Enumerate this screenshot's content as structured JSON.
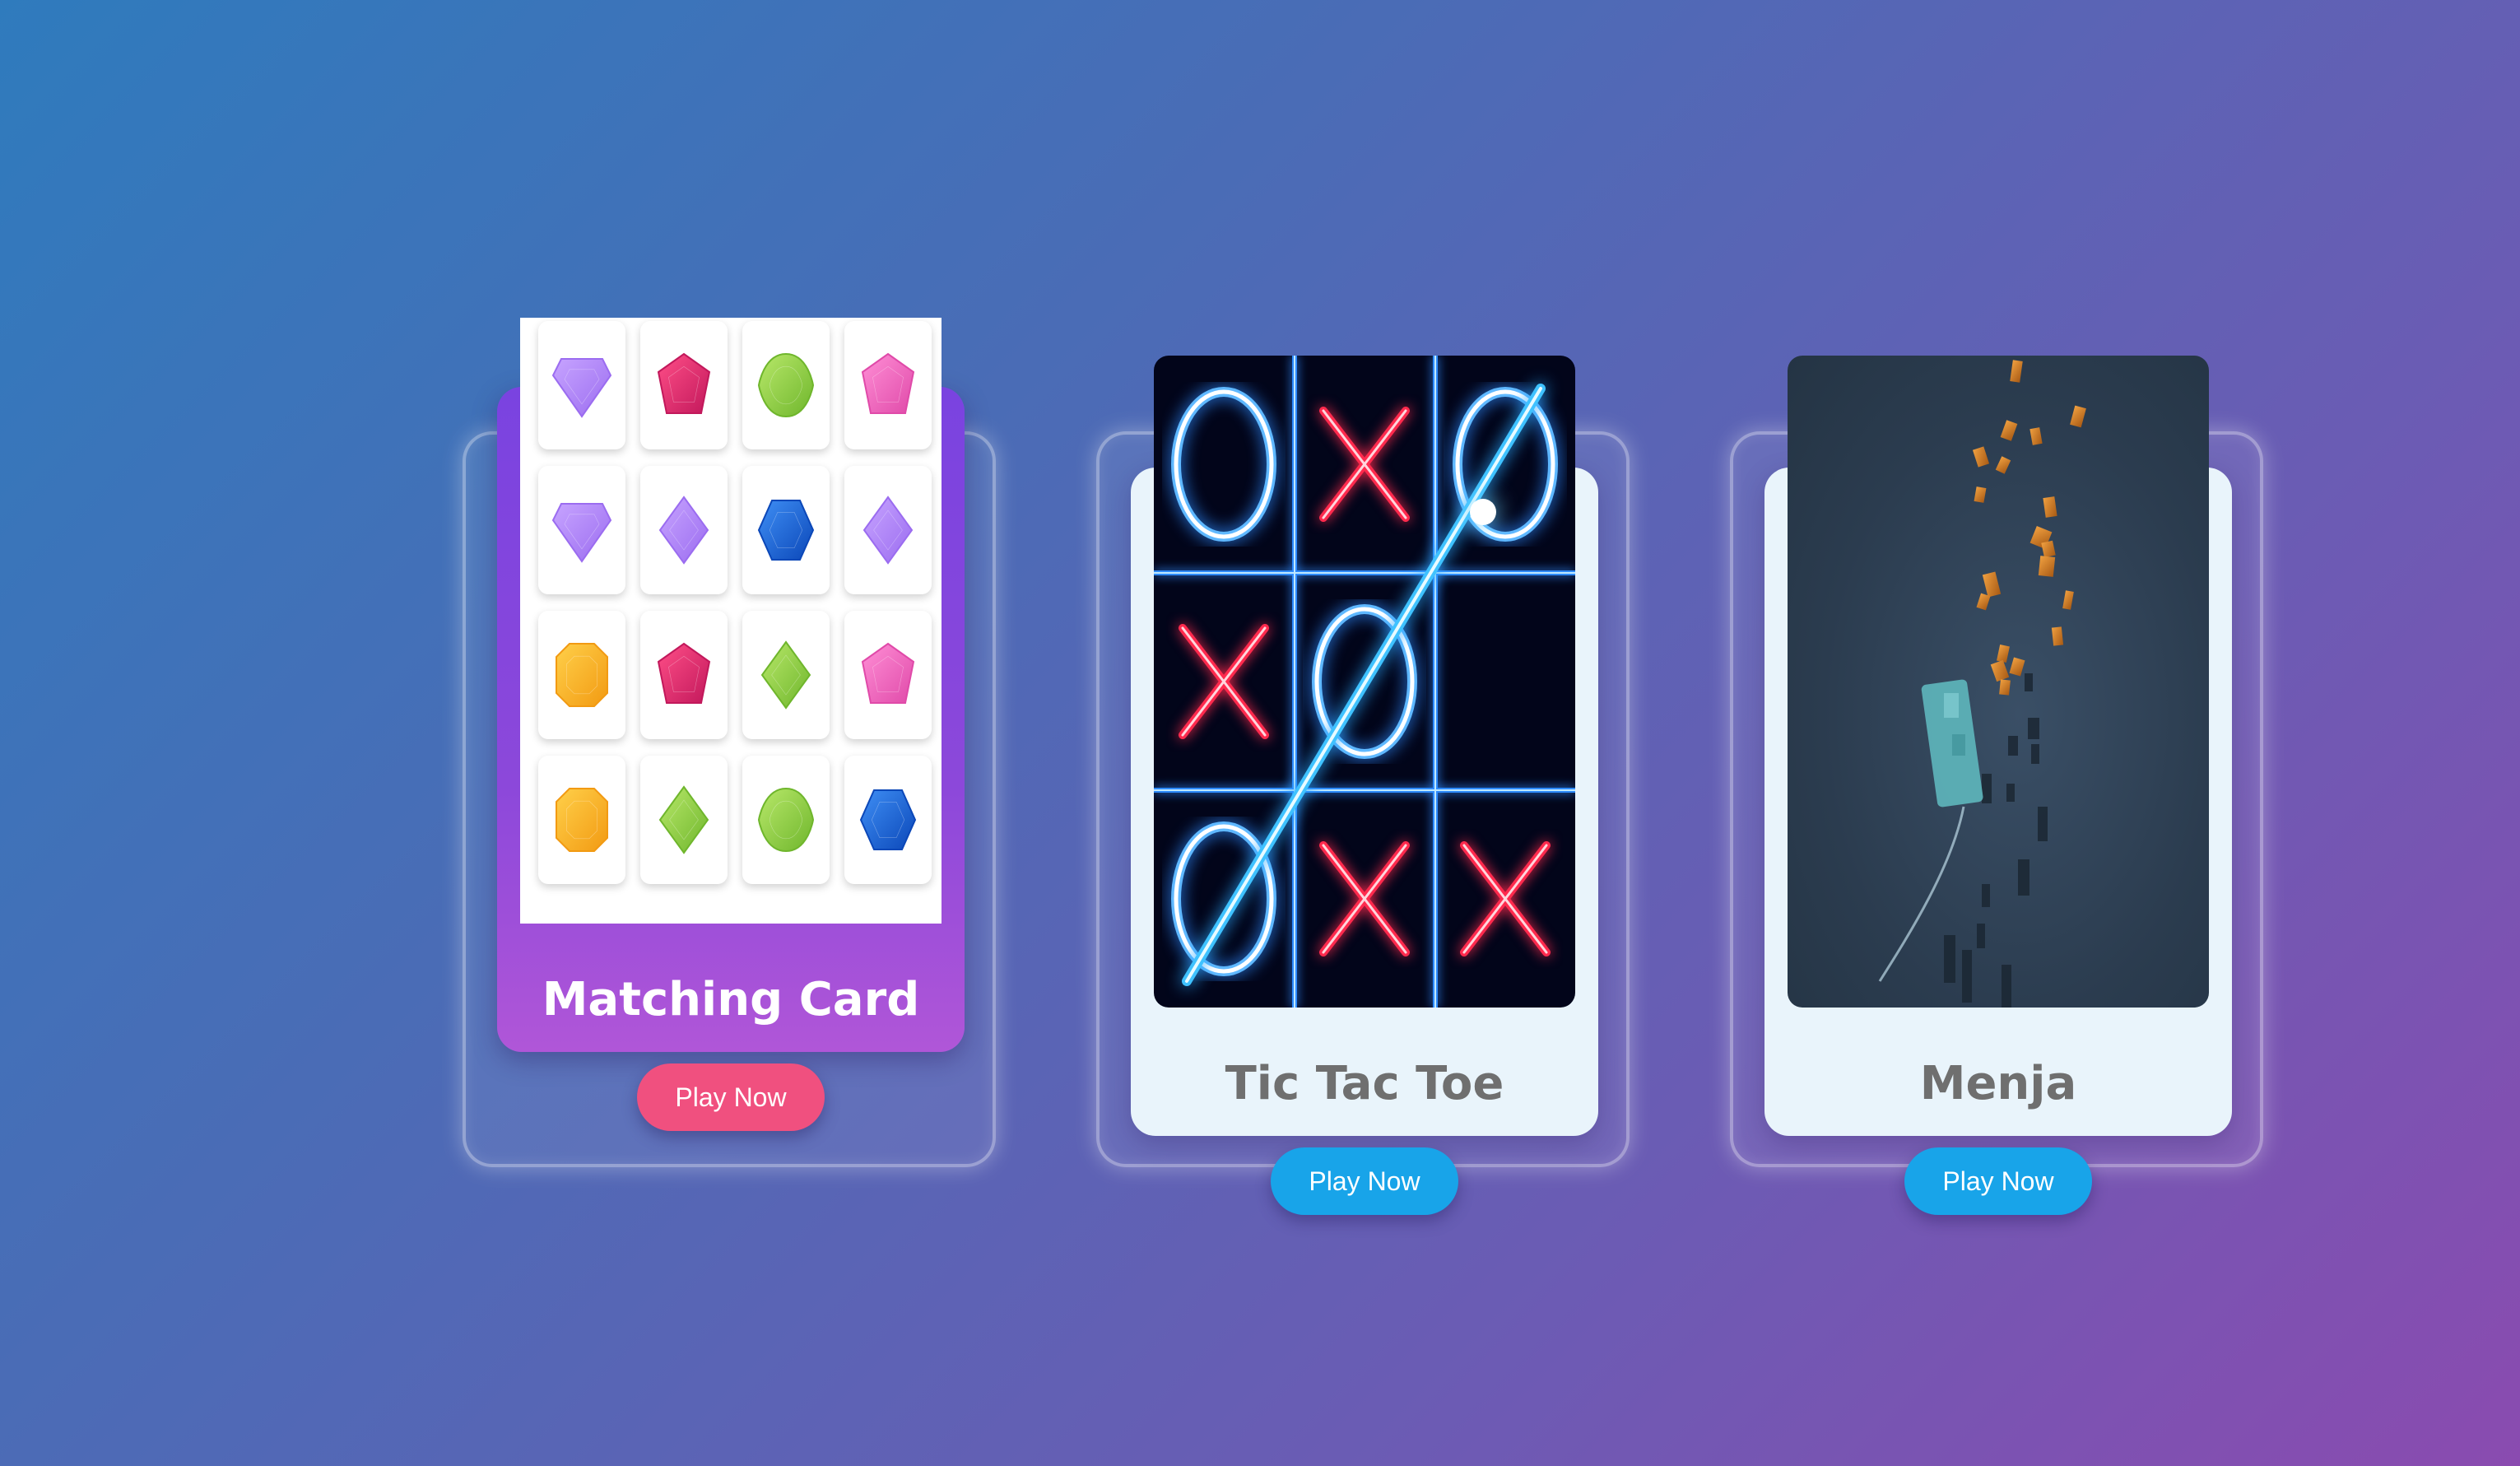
{
  "cards": [
    {
      "title": "Matching Card",
      "button_label": "Play Now",
      "gems": [
        [
          "diamond-violet",
          "pentagon-crimson",
          "oval-green",
          "pentagon-pink"
        ],
        [
          "diamond-violet",
          "rhombus-violet",
          "hexagon-blue",
          "rhombus-violet"
        ],
        [
          "octagon-orange",
          "pentagon-crimson",
          "rhombus-green",
          "pentagon-pink"
        ],
        [
          "octagon-orange",
          "rhombus-green",
          "oval-green",
          "hexagon-blue"
        ]
      ]
    },
    {
      "title": "Tic Tac Toe",
      "button_label": "Play Now",
      "board": [
        [
          "O",
          "X",
          "O"
        ],
        [
          "X",
          "O",
          ""
        ],
        [
          "O",
          "X",
          "X"
        ]
      ]
    },
    {
      "title": "Menja",
      "button_label": "Play Now"
    }
  ],
  "colors": {
    "accent_pink": "#f0507f",
    "accent_blue": "#18a4e9",
    "neon_x": "#ff2a4d",
    "neon_o": "#ffffff",
    "neon_grid": "#2e8bff"
  }
}
